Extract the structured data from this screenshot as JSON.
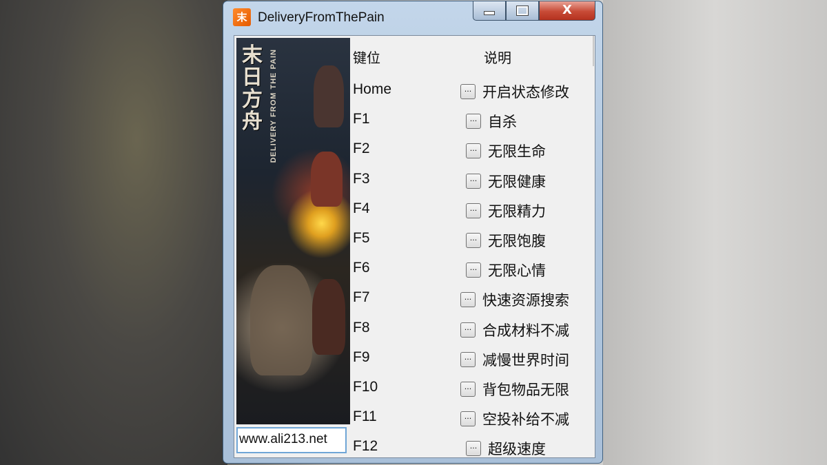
{
  "window": {
    "title": "DeliveryFromThePain",
    "icon": "game-logo-icon",
    "close_glyph": "X"
  },
  "banner": {
    "title_cn": "末日方舟",
    "subtitle": "DELIVERY FROM THE PAIN",
    "link": "www.ali213.net"
  },
  "table": {
    "header_key": "键位",
    "header_desc": "说明",
    "rows": [
      {
        "key": "Home",
        "desc": "开启状态修改"
      },
      {
        "key": "F1",
        "desc": "自杀"
      },
      {
        "key": "F2",
        "desc": "无限生命"
      },
      {
        "key": "F3",
        "desc": "无限健康"
      },
      {
        "key": "F4",
        "desc": "无限精力"
      },
      {
        "key": "F5",
        "desc": "无限饱腹"
      },
      {
        "key": "F6",
        "desc": "无限心情"
      },
      {
        "key": "F7",
        "desc": "快速资源搜索"
      },
      {
        "key": "F8",
        "desc": "合成材料不减"
      },
      {
        "key": "F9",
        "desc": "减慢世界时间"
      },
      {
        "key": "F10",
        "desc": "背包物品无限"
      },
      {
        "key": "F11",
        "desc": "空投补给不减"
      },
      {
        "key": "F12",
        "desc": "超级速度"
      }
    ],
    "button_label": "..."
  },
  "colors": {
    "close_button": "#c74a36",
    "titlebar": "#b2c8e0",
    "link_border": "#6fa5d6"
  }
}
